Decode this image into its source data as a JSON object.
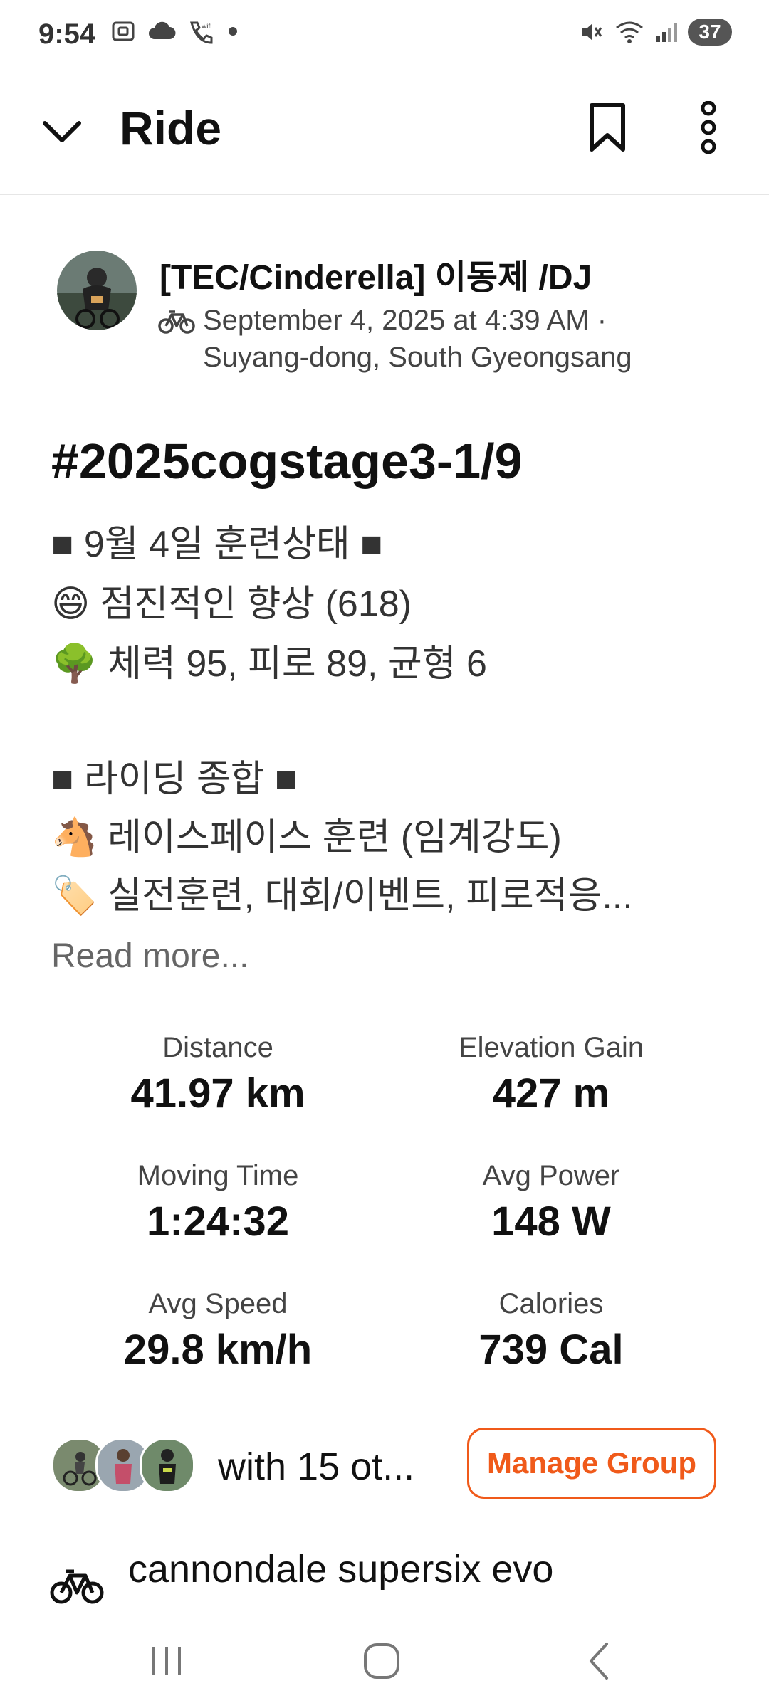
{
  "status_bar": {
    "time": "9:54",
    "battery": "37",
    "left_icons": [
      "screenshot-icon",
      "cloud-icon",
      "wifi-calling-icon",
      "dot-icon"
    ],
    "right_icons": [
      "mute-icon",
      "wifi-icon",
      "signal-icon"
    ]
  },
  "app_bar": {
    "title": "Ride"
  },
  "author": {
    "name": "[TEC/Cinderella] 이동제 /DJ",
    "meta_line1": "September 4, 2025 at 4:39 AM ·",
    "meta_line2": "Suyang-dong, South Gyeongsang"
  },
  "activity": {
    "title": "#2025cogstage3-1/9",
    "description": [
      "■ 9월 4일 훈련상태 ■",
      "😄 점진적인 향상 (618)",
      "🌳 체력 95, 피로 89, 균형 6",
      "",
      "■ 라이딩 종합 ■",
      "🐴 레이스페이스 훈련 (임계강도)",
      "🏷️ 실전훈련, 대회/이벤트, 피로적응..."
    ],
    "read_more": "Read more..."
  },
  "stats": [
    {
      "label": "Distance",
      "value": "41.97 km"
    },
    {
      "label": "Elevation Gain",
      "value": "427 m"
    },
    {
      "label": "Moving Time",
      "value": "1:24:32"
    },
    {
      "label": "Avg Power",
      "value": "148 W"
    },
    {
      "label": "Avg Speed",
      "value": "29.8 km/h"
    },
    {
      "label": "Calories",
      "value": "739 Cal"
    }
  ],
  "group": {
    "with_text": "with 15 ot...",
    "manage_label": "Manage Group"
  },
  "gear": {
    "name": "cannondale supersix evo"
  },
  "colors": {
    "accent": "#f05a1a",
    "text": "#111111",
    "secondary_text": "#444444"
  }
}
